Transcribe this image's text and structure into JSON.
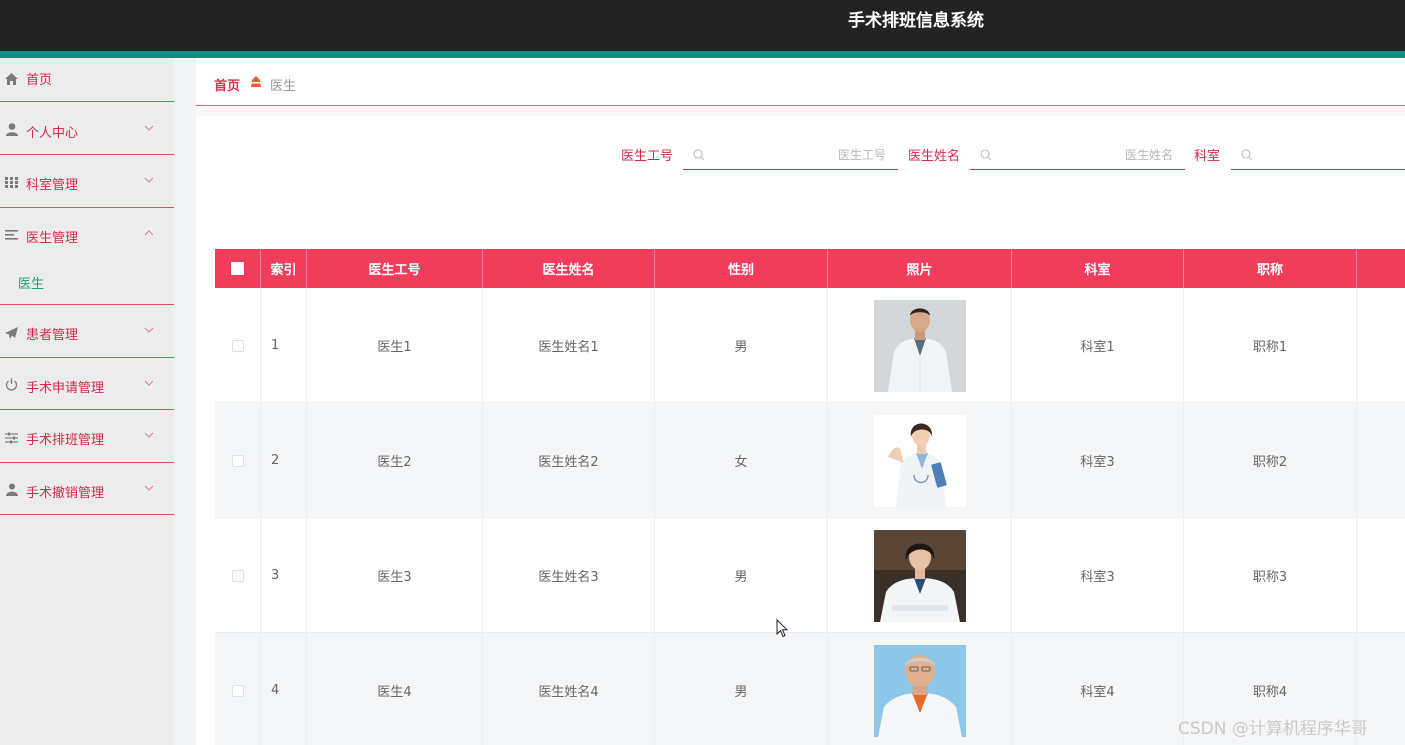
{
  "header": {
    "title": "手术排班信息系统"
  },
  "colors": {
    "accent": "#f23c5b",
    "sidebar_text": "#d6284a",
    "active_sub": "#17a176",
    "header_bg": "#232323",
    "strip": "#0d8f82"
  },
  "sidebar": {
    "items": [
      {
        "label": "首页",
        "icon": "home-icon"
      },
      {
        "label": "个人中心",
        "icon": "user-icon"
      },
      {
        "label": "科室管理",
        "icon": "grid-icon"
      },
      {
        "label": "医生管理",
        "icon": "list-icon"
      },
      {
        "label": "患者管理",
        "icon": "send-icon"
      },
      {
        "label": "手术申请管理",
        "icon": "power-icon"
      },
      {
        "label": "手术排班管理",
        "icon": "sliders-icon"
      },
      {
        "label": "手术撤销管理",
        "icon": "person-icon"
      }
    ],
    "submenu": {
      "label": "医生"
    }
  },
  "breadcrumb": {
    "home": "首页",
    "current": "医生"
  },
  "search": {
    "fields": [
      {
        "label": "医生工号",
        "placeholder": "医生工号"
      },
      {
        "label": "医生姓名",
        "placeholder": "医生姓名"
      },
      {
        "label": "科室",
        "placeholder": "科室"
      }
    ]
  },
  "table": {
    "headers": [
      "索引",
      "医生工号",
      "医生姓名",
      "性别",
      "照片",
      "科室",
      "职称"
    ],
    "rows": [
      {
        "index": "1",
        "id": "医生1",
        "name": "医生姓名1",
        "gender": "男",
        "dept": "科室1",
        "title": "职称1"
      },
      {
        "index": "2",
        "id": "医生2",
        "name": "医生姓名2",
        "gender": "女",
        "dept": "科室3",
        "title": "职称2"
      },
      {
        "index": "3",
        "id": "医生3",
        "name": "医生姓名3",
        "gender": "男",
        "dept": "科室3",
        "title": "职称3"
      },
      {
        "index": "4",
        "id": "医生4",
        "name": "医生姓名4",
        "gender": "男",
        "dept": "科室4",
        "title": "职称4"
      }
    ]
  },
  "watermark": "CSDN @计算机程序华哥"
}
